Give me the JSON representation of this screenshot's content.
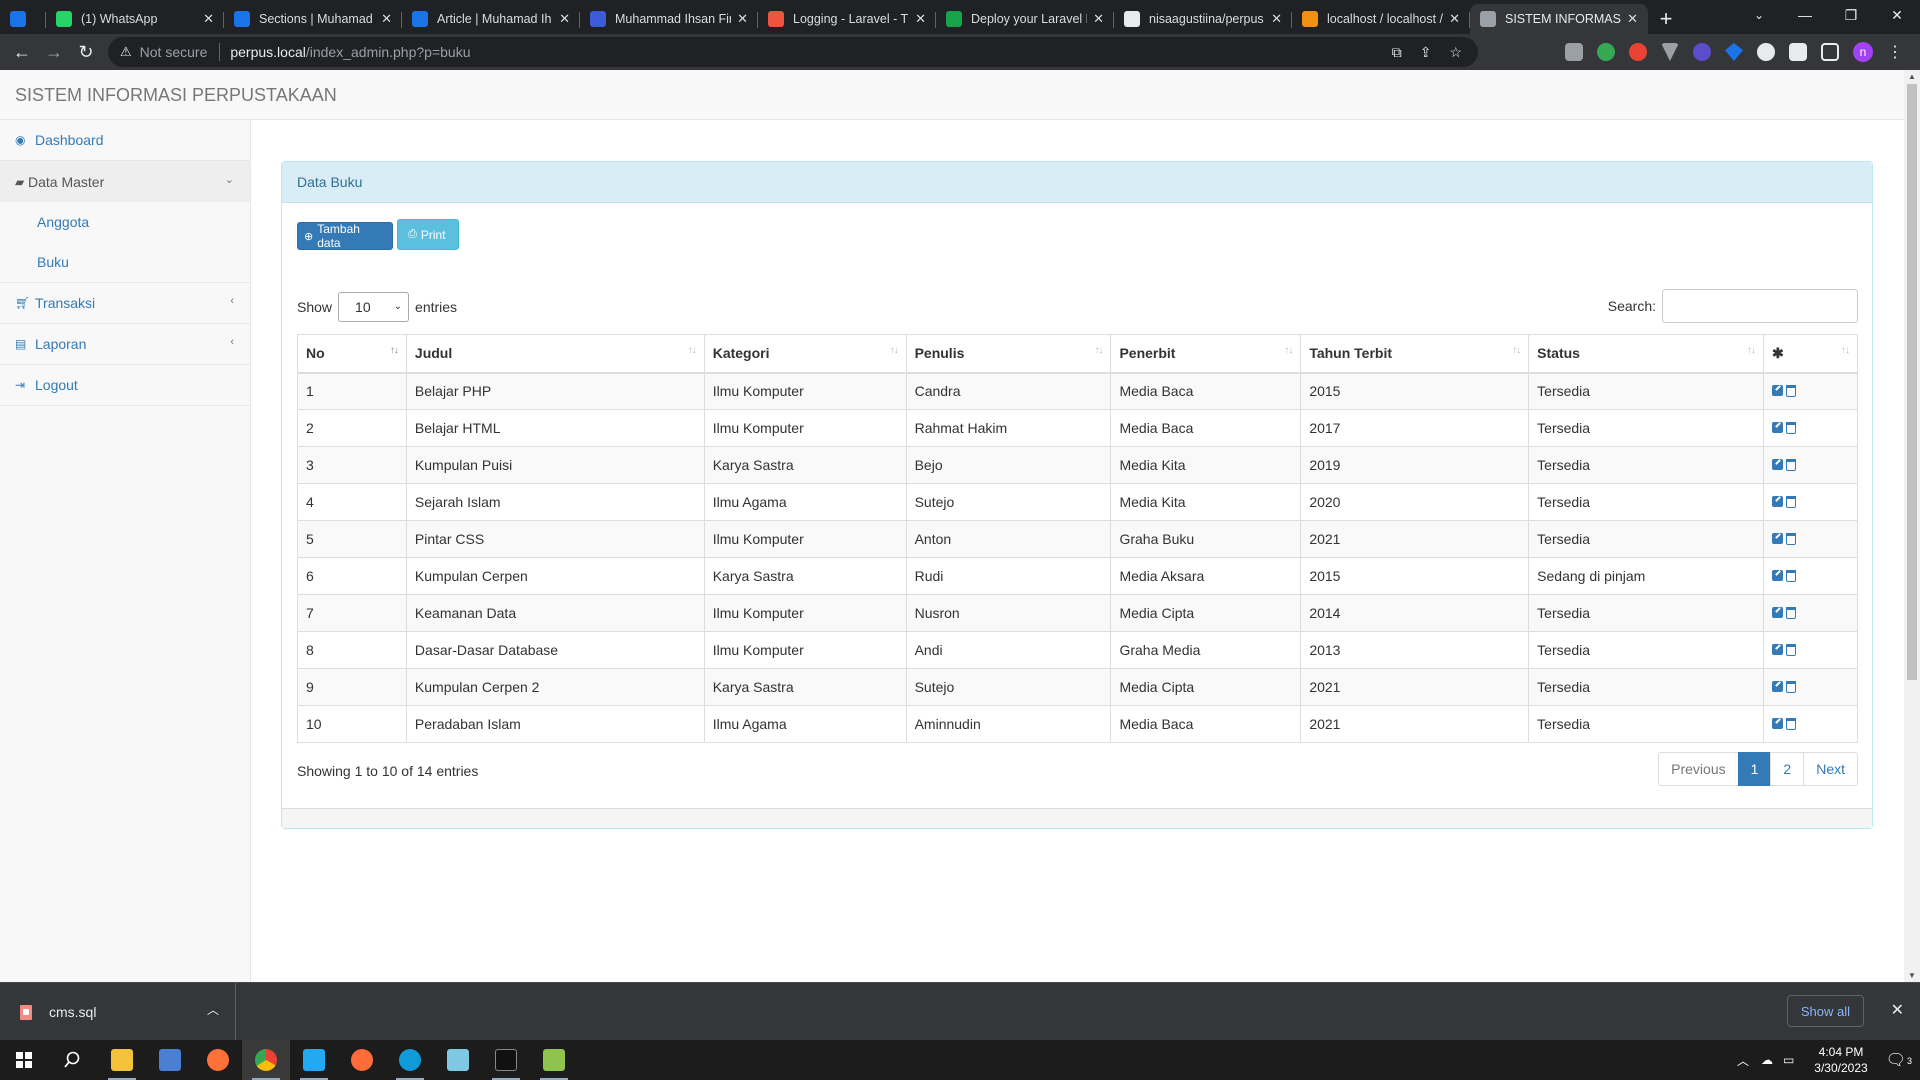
{
  "browser": {
    "tabs": [
      {
        "title": "",
        "favicon_color": "#1a73e8",
        "icon": "gem-icon"
      },
      {
        "title": "(1) WhatsApp",
        "favicon_color": "#25d366",
        "icon": "whatsapp-icon"
      },
      {
        "title": "Sections | Muhamad",
        "favicon_color": "#1a73e8",
        "icon": "blue-c-icon"
      },
      {
        "title": "Article | Muhamad Ih",
        "favicon_color": "#1a73e8",
        "icon": "blue-c-icon"
      },
      {
        "title": "Muhammad Ihsan Fir",
        "favicon_color": "#3b5bdb",
        "icon": "f-icon"
      },
      {
        "title": "Logging - Laravel - Th",
        "favicon_color": "#f05340",
        "icon": "laravel-icon"
      },
      {
        "title": "Deploy your Laravel P",
        "favicon_color": "#16a34a",
        "icon": "forge-icon"
      },
      {
        "title": "nisaagustiina/perpus",
        "favicon_color": "#e8eaed",
        "icon": "github-icon"
      },
      {
        "title": "localhost / localhost /",
        "favicon_color": "#f29111",
        "icon": "phpmyadmin-icon"
      },
      {
        "title": "SISTEM INFORMASI P",
        "favicon_color": "#9aa0a6",
        "icon": "globe-icon"
      }
    ],
    "new_tab": "+",
    "security_label": "Not secure",
    "url_host": "perpus.local",
    "url_path": "/index_admin.php?p=buku"
  },
  "app": {
    "brand": "SISTEM INFORMASI PERPUSTAKAAN",
    "sidebar": {
      "dashboard": "Dashboard",
      "data_master": "Data Master",
      "anggota": "Anggota",
      "buku": "Buku",
      "transaksi": "Transaksi",
      "laporan": "Laporan",
      "logout": "Logout"
    },
    "panel_title": "Data Buku",
    "buttons": {
      "add": "Tambah data",
      "print": "Print"
    },
    "length": {
      "show": "Show",
      "value": "10",
      "entries": "entries"
    },
    "search_label": "Search:",
    "columns": [
      "No",
      "Judul",
      "Kategori",
      "Penulis",
      "Penerbit",
      "Tahun Terbit",
      "Status"
    ],
    "rows": [
      [
        "1",
        "Belajar PHP",
        "Ilmu Komputer",
        "Candra",
        "Media Baca",
        "2015",
        "Tersedia"
      ],
      [
        "2",
        "Belajar HTML",
        "Ilmu Komputer",
        "Rahmat Hakim",
        "Media Baca",
        "2017",
        "Tersedia"
      ],
      [
        "3",
        "Kumpulan Puisi",
        "Karya Sastra",
        "Bejo",
        "Media Kita",
        "2019",
        "Tersedia"
      ],
      [
        "4",
        "Sejarah Islam",
        "Ilmu Agama",
        "Sutejo",
        "Media Kita",
        "2020",
        "Tersedia"
      ],
      [
        "5",
        "Pintar CSS",
        "Ilmu Komputer",
        "Anton",
        "Graha Buku",
        "2021",
        "Tersedia"
      ],
      [
        "6",
        "Kumpulan Cerpen",
        "Karya Sastra",
        "Rudi",
        "Media Aksara",
        "2015",
        "Sedang di pinjam"
      ],
      [
        "7",
        "Keamanan Data",
        "Ilmu Komputer",
        "Nusron",
        "Media Cipta",
        "2014",
        "Tersedia"
      ],
      [
        "8",
        "Dasar-Dasar Database",
        "Ilmu Komputer",
        "Andi",
        "Graha Media",
        "2013",
        "Tersedia"
      ],
      [
        "9",
        "Kumpulan Cerpen 2",
        "Karya Sastra",
        "Sutejo",
        "Media Cipta",
        "2021",
        "Tersedia"
      ],
      [
        "10",
        "Peradaban Islam",
        "Ilmu Agama",
        "Aminnudin",
        "Media Baca",
        "2021",
        "Tersedia"
      ]
    ],
    "info": "Showing 1 to 10 of 14 entries",
    "pagination": {
      "previous": "Previous",
      "pages": [
        "1",
        "2"
      ],
      "current": "1",
      "next": "Next"
    }
  },
  "downloads": {
    "file": "cms.sql",
    "show_all": "Show all"
  },
  "taskbar": {
    "time": "4:04 PM",
    "date": "3/30/2023",
    "notifications": "3"
  },
  "colors": {
    "primary": "#337ab7",
    "info": "#5bc0de",
    "panel_heading": "#d9edf7"
  }
}
